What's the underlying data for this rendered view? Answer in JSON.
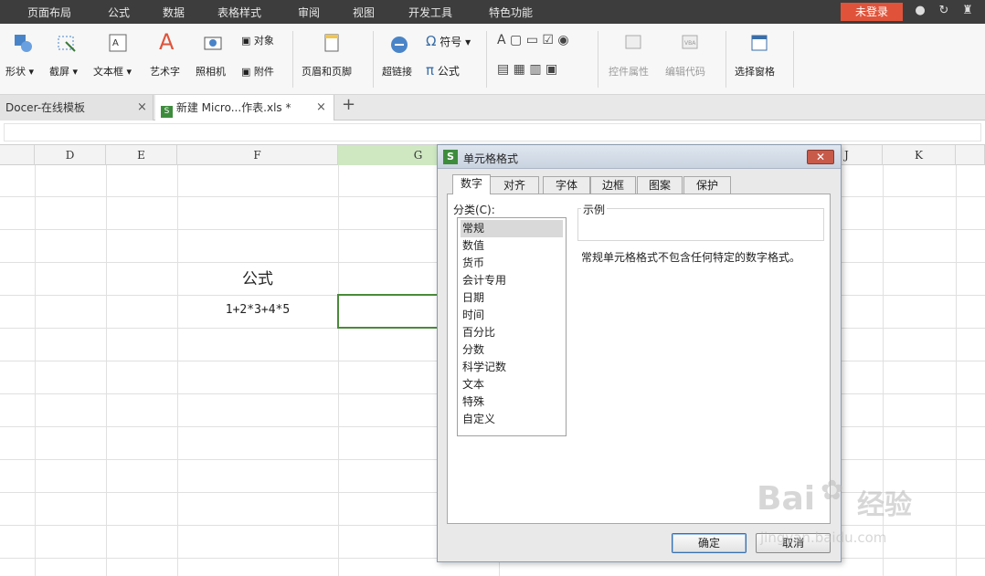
{
  "menubar": {
    "items": [
      "页面布局",
      "公式",
      "数据",
      "表格样式",
      "审阅",
      "视图",
      "开发工具",
      "特色功能"
    ],
    "login_label": "未登录"
  },
  "ribbon": {
    "shape": "形状",
    "screenshot": "截屏",
    "textbox": "文本框",
    "wordart": "艺术字",
    "camera": "照相机",
    "object": "对象",
    "attachment": "附件",
    "header_footer": "页眉和页脚",
    "hyperlink": "超链接",
    "symbol": "符号",
    "formula": "公式",
    "control_props": "控件属性",
    "edit_code": "编辑代码",
    "select_pane": "选择窗格",
    "dropdown_marker": "▾",
    "text_char": "A"
  },
  "tabs": {
    "items": [
      {
        "label": "Docer-在线模板",
        "close": "×"
      },
      {
        "label": "新建 Micro...作表.xls *",
        "close": "×"
      }
    ],
    "add": "+"
  },
  "grid": {
    "columns": [
      "D",
      "E",
      "F",
      "G",
      "J",
      "K"
    ],
    "active_column": "G",
    "cells": {
      "f_title": "公式",
      "f_expr": "1+2*3+4*5"
    }
  },
  "dialog": {
    "title": "单元格格式",
    "title_icon_char": "S",
    "close_char": "✕",
    "tabs": [
      "数字",
      "对齐",
      "字体",
      "边框",
      "图案",
      "保护"
    ],
    "active_tab": "数字",
    "category_label": "分类(C):",
    "categories": [
      "常规",
      "数值",
      "货币",
      "会计专用",
      "日期",
      "时间",
      "百分比",
      "分数",
      "科学记数",
      "文本",
      "特殊",
      "自定义"
    ],
    "selected_category": "常规",
    "sample_label": "示例",
    "description": "常规单元格格式不包含任何特定的数字格式。",
    "ok_label": "确定",
    "cancel_label": "取消"
  },
  "watermark": {
    "brand": "Bai",
    "brand_suffix": "经验",
    "url": "jingyan.baidu.com"
  },
  "colors": {
    "menubar_bg": "#3d3d3d",
    "login_bg": "#e0533a",
    "active_column_bg": "#cfe8c2",
    "selection_border": "#4a8a3a"
  }
}
